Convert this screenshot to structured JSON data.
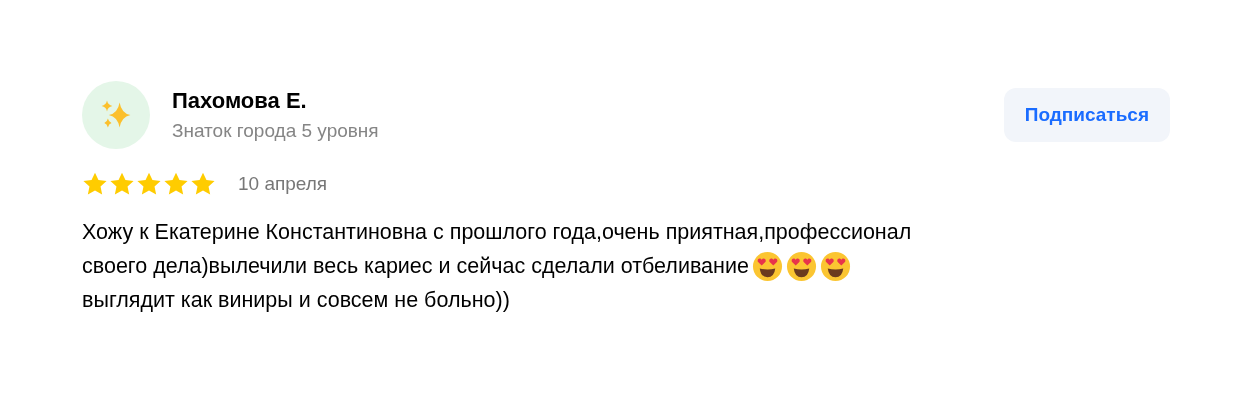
{
  "author": {
    "name": "Пахомова Е.",
    "subtitle": "Знаток города 5 уровня"
  },
  "subscribe_button": "Подписаться",
  "rating": {
    "stars": 5,
    "date": "10 апреля"
  },
  "review_lines": [
    [
      {
        "kind": "text",
        "text": "Хожу к Екатерине Константиновна с прошлого года,очень приятная,профессионал"
      }
    ],
    [
      {
        "kind": "text",
        "text": "своего дела)вылечили весь кариес и сейчас сделали отбеливание"
      },
      {
        "kind": "emoji"
      },
      {
        "kind": "emoji"
      },
      {
        "kind": "emoji"
      }
    ],
    [
      {
        "kind": "text",
        "text": "выглядит как виниры и совсем не больно))"
      }
    ]
  ]
}
